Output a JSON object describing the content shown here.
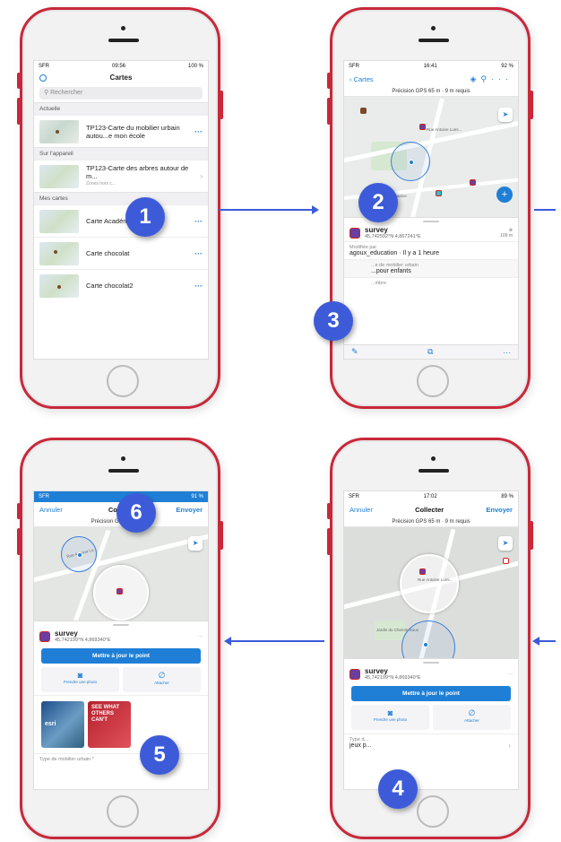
{
  "colors": {
    "accent": "#1f7fd6",
    "phone_frame": "#c8283a",
    "arrow": "#3d5bd9",
    "badge": "#3d5bd9"
  },
  "steps": [
    "1",
    "2",
    "3",
    "4",
    "5",
    "6"
  ],
  "phone1": {
    "status": {
      "carrier": "SFR",
      "time": "09:56",
      "battery": "100 %"
    },
    "title": "Cartes",
    "search_placeholder": "Rechercher",
    "sections": {
      "current": "Actuelle",
      "device": "Sur l'appareil",
      "my_maps": "Mes cartes"
    },
    "current_map": "TP123-Carte du mobilier urbain autou...e mon école",
    "device_map": {
      "title": "TP123-Carte des arbres autour de m...",
      "sub": "Zones hors c..."
    },
    "my_maps": [
      "Carte Académie",
      "Carte chocolat",
      "Carte chocolat2"
    ]
  },
  "phone2": {
    "status": {
      "carrier": "SFR",
      "time": "16:41",
      "battery": "92 %"
    },
    "back_label": "Cartes",
    "gps": "Précision GPS 65 m · 9 m requis",
    "street": "Rue Antoine Lumi...",
    "place": "...Maurice",
    "feature": {
      "name": "survey",
      "coords": "45,742592°N 4,867241°E",
      "distance": "109 m"
    },
    "modified_label": "Modifiée par",
    "modified_value": "agoux_education · Il y a 1 heure",
    "type_label": "...e de mobilier urbain",
    "type_value": "...pour enfants",
    "number_label": "...mbre"
  },
  "phone3": {
    "status": {
      "carrier": "SFR",
      "battery": "91 %"
    },
    "cancel": "Annuler",
    "title": "Colle...",
    "send": "Envoyer",
    "gps": "Précision GPS 6... ...quis",
    "street": "Rue Antoine Lu...",
    "feature": {
      "name": "survey",
      "coords": "45,742199°N 4,869340°E"
    },
    "update_button": "Mettre à jour le point",
    "photo_action": "Prendre une photo",
    "attach_action": "Attacher",
    "photo_b_text": "SEE WHAT OTHERS CAN'T",
    "photo_a_text": "esri",
    "type_label": "Type de mobilier urbain *"
  },
  "phone4": {
    "status": {
      "carrier": "SFR",
      "time": "17:02",
      "battery": "89 %"
    },
    "cancel": "Annuler",
    "title": "Collecter",
    "send": "Envoyer",
    "gps": "Précision GPS 65 m · 9 m requis",
    "street": "Rue Antoine Lumi...",
    "park": "Jardin du Chemin Roux",
    "feature": {
      "name": "survey",
      "coords": "45,742199°N 4,869340°E"
    },
    "update_button": "Mettre à jour le point",
    "photo_action": "Prendre une photo",
    "attach_action": "Attacher",
    "type_label": "Type d...",
    "type_value": "jeux p..."
  }
}
